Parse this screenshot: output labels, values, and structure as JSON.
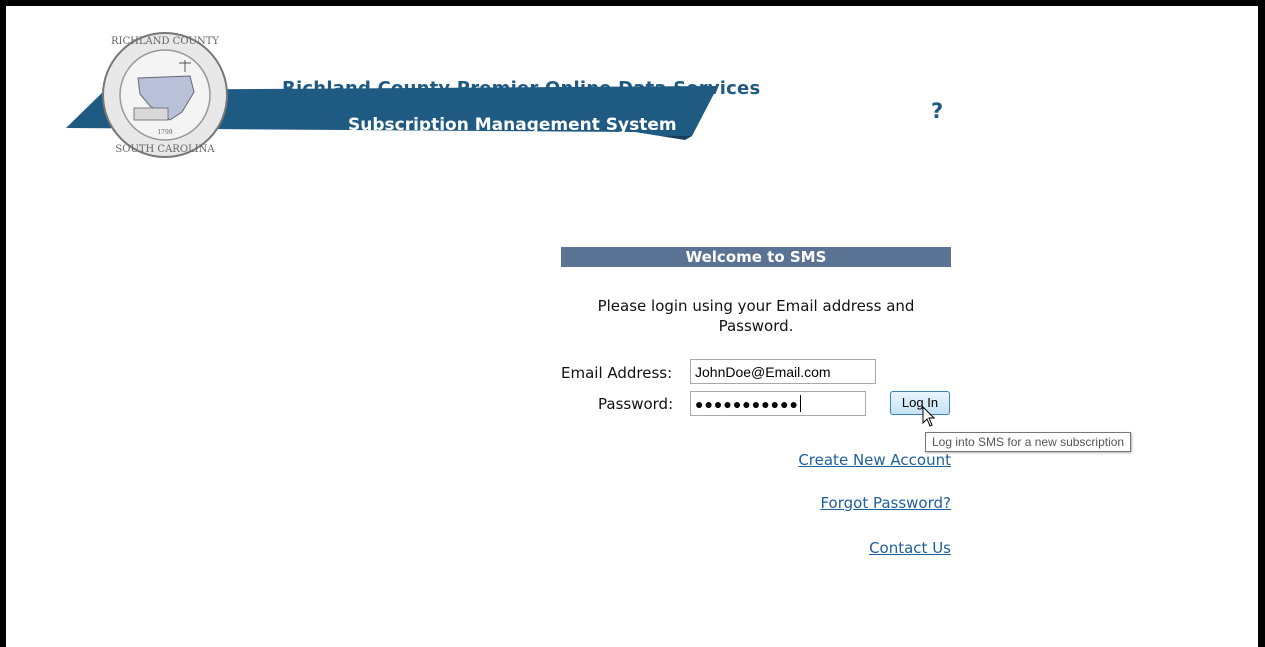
{
  "header": {
    "title": "Richland County Premier Online Data Services",
    "subtitle": "Subscription Management System",
    "seal_text": "RICHLAND COUNTY • SOUTH CAROLINA",
    "seal_year": "1799",
    "help_icon": "?"
  },
  "login": {
    "welcome": "Welcome to SMS",
    "instructions": "Please login using your Email address and Password.",
    "email_label": "Email Address:",
    "email_value": "JohnDoe@Email.com",
    "password_label": "Password:",
    "password_value": "●●●●●●●●●●●",
    "login_button": "Log In",
    "tooltip": "Log into SMS for a new subscription"
  },
  "links": {
    "create_account": "Create New Account",
    "forgot_password": "Forgot Password?",
    "contact_us": "Contact Us"
  },
  "colors": {
    "brand_blue": "#1f5a82",
    "welcome_bar": "#5a7394",
    "link": "#1f5fa0"
  },
  "icons": {
    "help": "question-mark-icon",
    "cursor": "mouse-pointer-icon"
  }
}
